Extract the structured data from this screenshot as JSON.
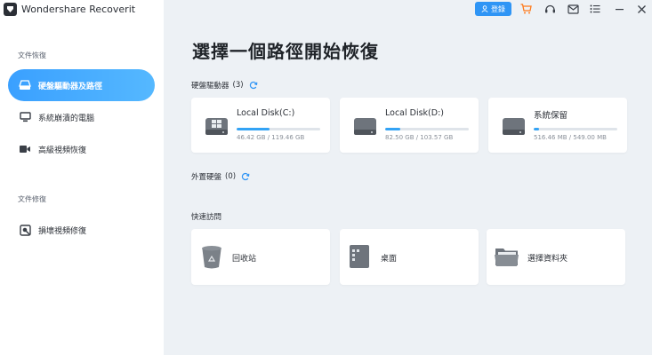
{
  "app": {
    "title": "Wondershare Recoverit"
  },
  "toolbar": {
    "login_label": "登錄"
  },
  "sidebar": {
    "section_recover": "文件恢復",
    "section_repair": "文件修復",
    "items": [
      {
        "label": "硬盤驅動器及路徑",
        "icon": "hard-drive-icon",
        "active": true
      },
      {
        "label": "系統崩潰的電腦",
        "icon": "crashed-computer-icon",
        "active": false
      },
      {
        "label": "高級視頻恢復",
        "icon": "video-camera-icon",
        "active": false
      },
      {
        "label": "損壞視頻修復",
        "icon": "video-repair-icon",
        "active": false
      }
    ]
  },
  "main": {
    "title": "選擇一個路徑開始恢復",
    "drives_section": {
      "label": "硬盤驅動器",
      "count": "(3)"
    },
    "drives": [
      {
        "name": "Local Disk(C:)",
        "size": "46.42 GB / 119.46 GB",
        "used_fraction": 0.39,
        "icon": "windows-drive-icon"
      },
      {
        "name": "Local Disk(D:)",
        "size": "82.50 GB / 103.57 GB",
        "used_fraction": 0.18,
        "icon": "drive-icon"
      },
      {
        "name": "系統保留",
        "size": "516.46 MB / 549.00 MB",
        "used_fraction": 0.06,
        "icon": "drive-icon"
      }
    ],
    "external_section": {
      "label": "外置硬盤",
      "count": "(0)"
    },
    "quick_section": {
      "label": "快速訪問"
    },
    "quick": [
      {
        "label": "回收站",
        "icon": "recycle-bin-icon"
      },
      {
        "label": "桌面",
        "icon": "desktop-icon"
      },
      {
        "label": "選擇資料夾",
        "icon": "folder-icon"
      }
    ]
  },
  "colors": {
    "accent": "#2f95f5",
    "sidebar_active": "#3aa0ff",
    "main_bg": "#edf1f5",
    "bar_fill": "#33a3f5"
  }
}
